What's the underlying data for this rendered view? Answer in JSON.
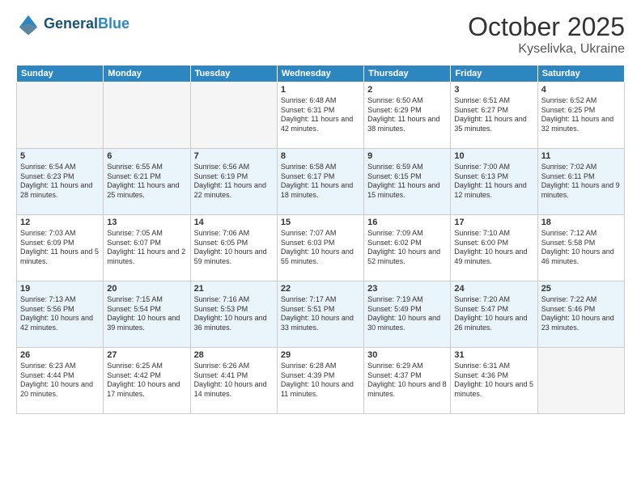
{
  "header": {
    "logo_line1": "General",
    "logo_line2": "Blue",
    "month": "October 2025",
    "location": "Kyselivka, Ukraine"
  },
  "weekdays": [
    "Sunday",
    "Monday",
    "Tuesday",
    "Wednesday",
    "Thursday",
    "Friday",
    "Saturday"
  ],
  "weeks": [
    [
      {
        "day": "",
        "info": ""
      },
      {
        "day": "",
        "info": ""
      },
      {
        "day": "",
        "info": ""
      },
      {
        "day": "1",
        "info": "Sunrise: 6:48 AM\nSunset: 6:31 PM\nDaylight: 11 hours and 42 minutes."
      },
      {
        "day": "2",
        "info": "Sunrise: 6:50 AM\nSunset: 6:29 PM\nDaylight: 11 hours and 38 minutes."
      },
      {
        "day": "3",
        "info": "Sunrise: 6:51 AM\nSunset: 6:27 PM\nDaylight: 11 hours and 35 minutes."
      },
      {
        "day": "4",
        "info": "Sunrise: 6:52 AM\nSunset: 6:25 PM\nDaylight: 11 hours and 32 minutes."
      }
    ],
    [
      {
        "day": "5",
        "info": "Sunrise: 6:54 AM\nSunset: 6:23 PM\nDaylight: 11 hours and 28 minutes."
      },
      {
        "day": "6",
        "info": "Sunrise: 6:55 AM\nSunset: 6:21 PM\nDaylight: 11 hours and 25 minutes."
      },
      {
        "day": "7",
        "info": "Sunrise: 6:56 AM\nSunset: 6:19 PM\nDaylight: 11 hours and 22 minutes."
      },
      {
        "day": "8",
        "info": "Sunrise: 6:58 AM\nSunset: 6:17 PM\nDaylight: 11 hours and 18 minutes."
      },
      {
        "day": "9",
        "info": "Sunrise: 6:59 AM\nSunset: 6:15 PM\nDaylight: 11 hours and 15 minutes."
      },
      {
        "day": "10",
        "info": "Sunrise: 7:00 AM\nSunset: 6:13 PM\nDaylight: 11 hours and 12 minutes."
      },
      {
        "day": "11",
        "info": "Sunrise: 7:02 AM\nSunset: 6:11 PM\nDaylight: 11 hours and 9 minutes."
      }
    ],
    [
      {
        "day": "12",
        "info": "Sunrise: 7:03 AM\nSunset: 6:09 PM\nDaylight: 11 hours and 5 minutes."
      },
      {
        "day": "13",
        "info": "Sunrise: 7:05 AM\nSunset: 6:07 PM\nDaylight: 11 hours and 2 minutes."
      },
      {
        "day": "14",
        "info": "Sunrise: 7:06 AM\nSunset: 6:05 PM\nDaylight: 10 hours and 59 minutes."
      },
      {
        "day": "15",
        "info": "Sunrise: 7:07 AM\nSunset: 6:03 PM\nDaylight: 10 hours and 55 minutes."
      },
      {
        "day": "16",
        "info": "Sunrise: 7:09 AM\nSunset: 6:02 PM\nDaylight: 10 hours and 52 minutes."
      },
      {
        "day": "17",
        "info": "Sunrise: 7:10 AM\nSunset: 6:00 PM\nDaylight: 10 hours and 49 minutes."
      },
      {
        "day": "18",
        "info": "Sunrise: 7:12 AM\nSunset: 5:58 PM\nDaylight: 10 hours and 46 minutes."
      }
    ],
    [
      {
        "day": "19",
        "info": "Sunrise: 7:13 AM\nSunset: 5:56 PM\nDaylight: 10 hours and 42 minutes."
      },
      {
        "day": "20",
        "info": "Sunrise: 7:15 AM\nSunset: 5:54 PM\nDaylight: 10 hours and 39 minutes."
      },
      {
        "day": "21",
        "info": "Sunrise: 7:16 AM\nSunset: 5:53 PM\nDaylight: 10 hours and 36 minutes."
      },
      {
        "day": "22",
        "info": "Sunrise: 7:17 AM\nSunset: 5:51 PM\nDaylight: 10 hours and 33 minutes."
      },
      {
        "day": "23",
        "info": "Sunrise: 7:19 AM\nSunset: 5:49 PM\nDaylight: 10 hours and 30 minutes."
      },
      {
        "day": "24",
        "info": "Sunrise: 7:20 AM\nSunset: 5:47 PM\nDaylight: 10 hours and 26 minutes."
      },
      {
        "day": "25",
        "info": "Sunrise: 7:22 AM\nSunset: 5:46 PM\nDaylight: 10 hours and 23 minutes."
      }
    ],
    [
      {
        "day": "26",
        "info": "Sunrise: 6:23 AM\nSunset: 4:44 PM\nDaylight: 10 hours and 20 minutes."
      },
      {
        "day": "27",
        "info": "Sunrise: 6:25 AM\nSunset: 4:42 PM\nDaylight: 10 hours and 17 minutes."
      },
      {
        "day": "28",
        "info": "Sunrise: 6:26 AM\nSunset: 4:41 PM\nDaylight: 10 hours and 14 minutes."
      },
      {
        "day": "29",
        "info": "Sunrise: 6:28 AM\nSunset: 4:39 PM\nDaylight: 10 hours and 11 minutes."
      },
      {
        "day": "30",
        "info": "Sunrise: 6:29 AM\nSunset: 4:37 PM\nDaylight: 10 hours and 8 minutes."
      },
      {
        "day": "31",
        "info": "Sunrise: 6:31 AM\nSunset: 4:36 PM\nDaylight: 10 hours and 5 minutes."
      },
      {
        "day": "",
        "info": ""
      }
    ]
  ]
}
